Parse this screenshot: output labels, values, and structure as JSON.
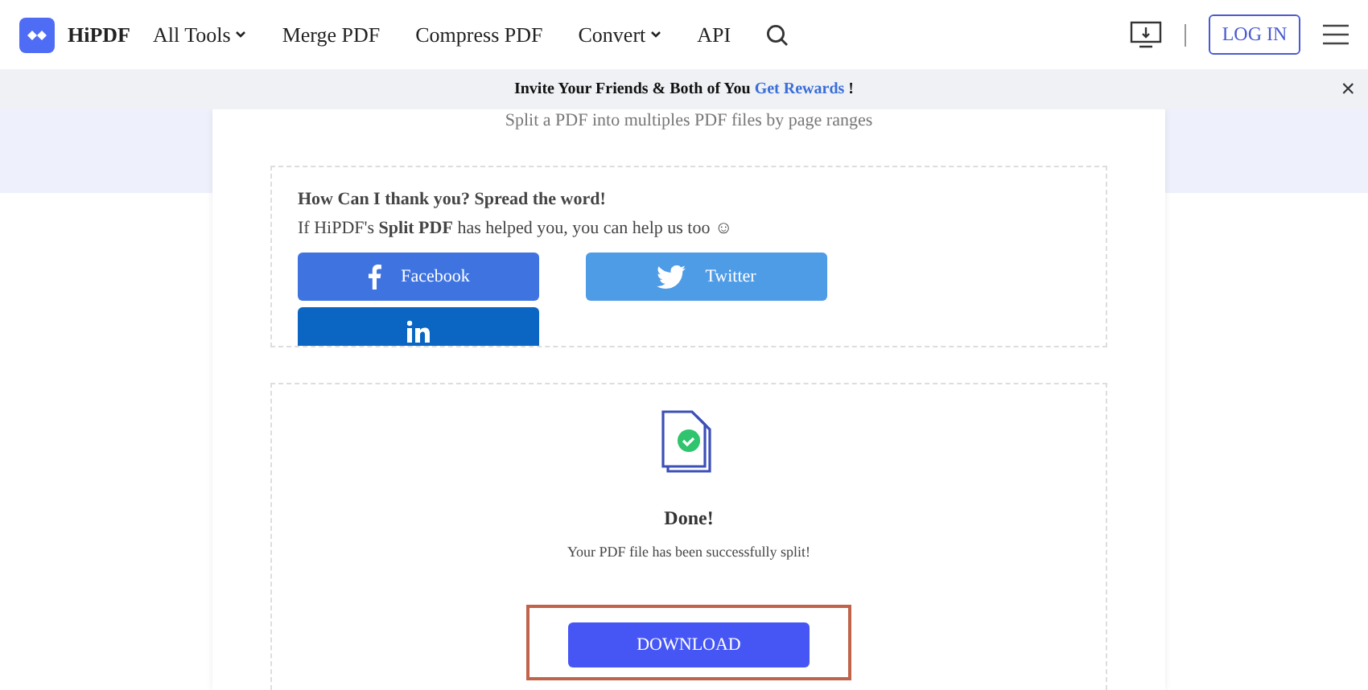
{
  "nav": {
    "brand": "HiPDF",
    "items": [
      {
        "label": "All Tools",
        "dropdown": true
      },
      {
        "label": "Merge PDF",
        "dropdown": false
      },
      {
        "label": "Compress PDF",
        "dropdown": false
      },
      {
        "label": "Convert",
        "dropdown": true
      },
      {
        "label": "API",
        "dropdown": false
      }
    ],
    "login": "LOG IN"
  },
  "banner": {
    "link": "Get Rewards",
    "prefix": "Invite Your Friends & Both of You ",
    "suffix": " !",
    "close": "×"
  },
  "subtitle": "Split a PDF into multiples PDF files by page ranges",
  "share": {
    "title": "How Can I thank you? Spread the word!",
    "text": "If HiPDF's **Split PDF** has helped you, you can help us too ☺",
    "buttons": [
      {
        "kind": "facebook",
        "label": "Facebook"
      },
      {
        "kind": "twitter",
        "label": "Twitter"
      },
      {
        "kind": "linkedin"
      }
    ]
  },
  "result": {
    "title": "Done!",
    "message": "Your PDF file has been successfully split!",
    "button": "DOWNLOAD"
  }
}
